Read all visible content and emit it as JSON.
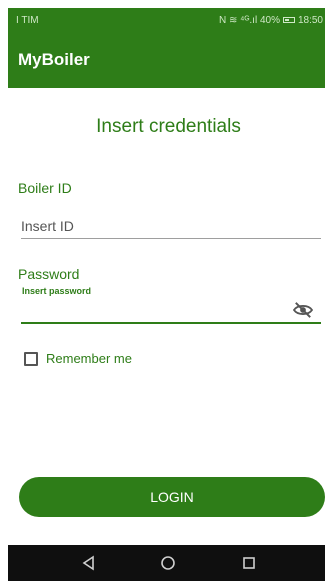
{
  "status_bar": {
    "carrier": "I TIM",
    "indicators": "N ≋ ⁴ᴳ.ıl 40%",
    "battery_icon": "battery-icon",
    "time": "18:50"
  },
  "app_bar": {
    "title": "MyBoiler"
  },
  "main": {
    "title": "Insert credentials",
    "boiler_id": {
      "label": "Boiler ID",
      "value": "Insert ID"
    },
    "password": {
      "label": "Password",
      "hint": "Insert password",
      "value": "",
      "toggle_icon": "eye-slash-icon"
    },
    "remember_me": {
      "label": "Remember me",
      "checked": false
    },
    "login_button": "LOGIN"
  },
  "nav_bar": {
    "back_icon": "back-icon",
    "home_icon": "home-icon",
    "recents_icon": "recents-icon"
  },
  "colors": {
    "primary": "#2e7d18",
    "navbar": "#0f0f0f",
    "underline": "#9e9e9e"
  }
}
